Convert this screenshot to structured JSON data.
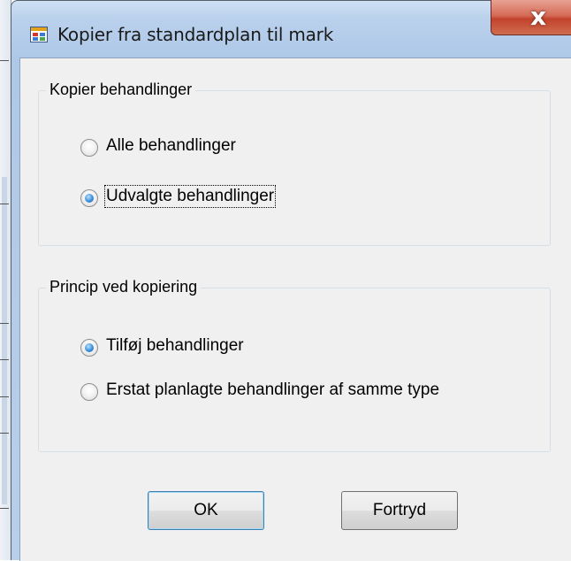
{
  "window": {
    "title": "Kopier fra standardplan til mark",
    "close_symbol": "x",
    "icon": "app-window-icon"
  },
  "group_treatments": {
    "legend": "Kopier behandlinger",
    "options": [
      {
        "label": "Alle behandlinger",
        "checked": false
      },
      {
        "label": "Udvalgte behandlinger",
        "checked": true
      }
    ]
  },
  "group_principle": {
    "legend": "Princip ved kopiering",
    "options": [
      {
        "label": "Tilføj behandlinger",
        "checked": true
      },
      {
        "label": "Erstat planlagte behandlinger af samme type",
        "checked": false
      }
    ]
  },
  "buttons": {
    "ok_label": "OK",
    "cancel_label": "Fortryd"
  },
  "colors": {
    "title_bar": "#bad1ec",
    "close_button": "#c2432b",
    "dialog_body": "#f0f0f0",
    "radio_checked": "#3e8fd8"
  }
}
